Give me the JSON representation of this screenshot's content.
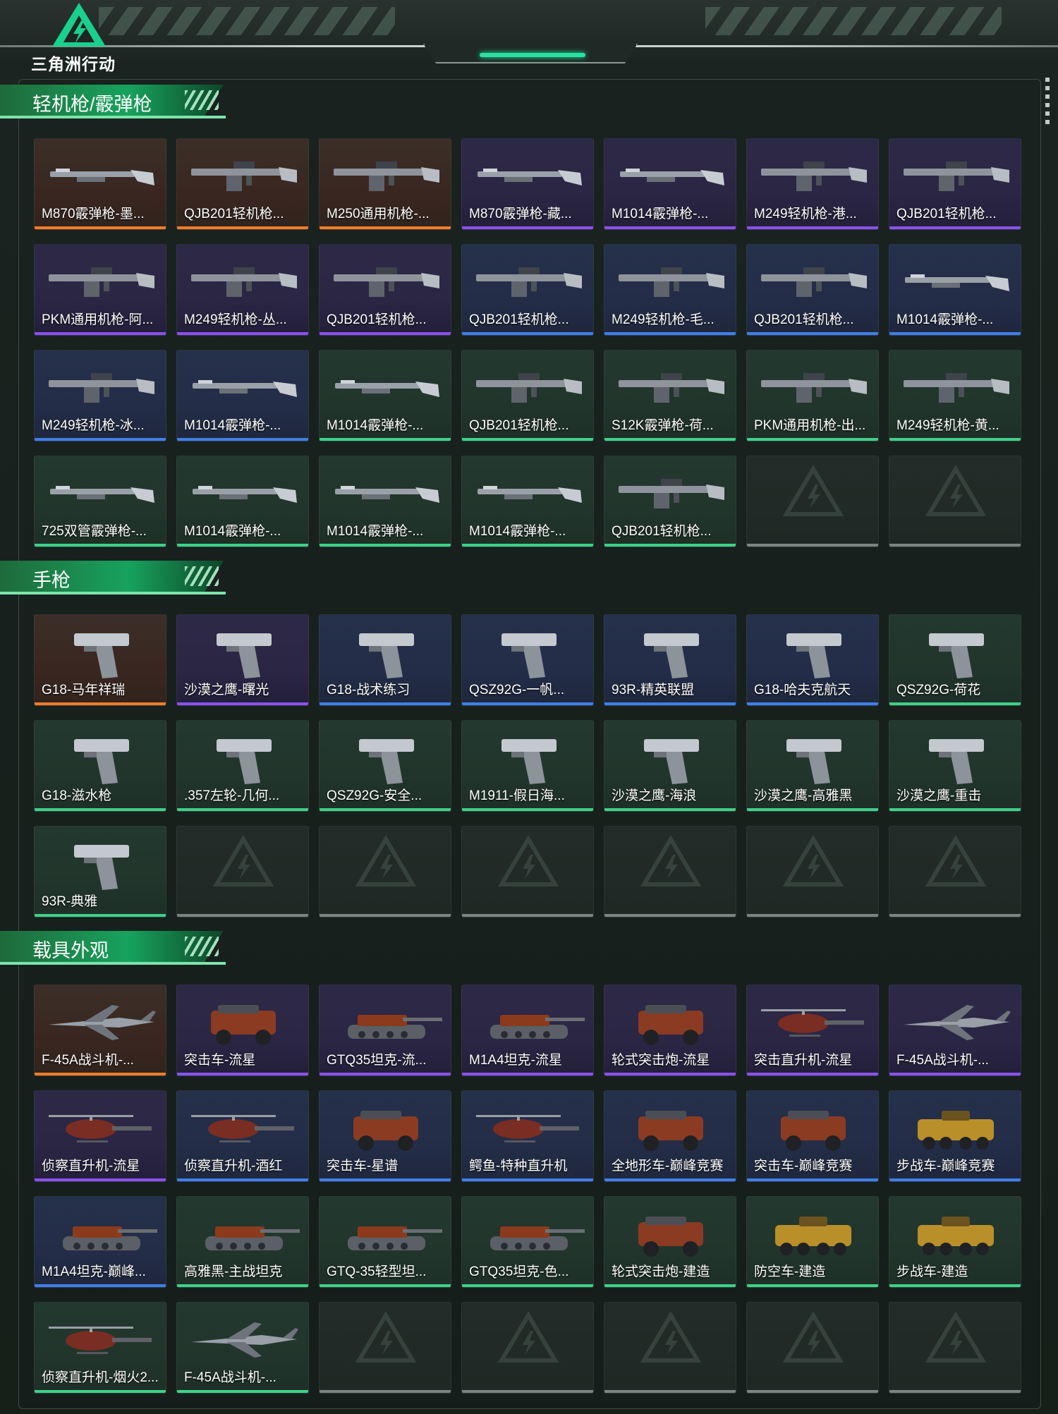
{
  "header": {
    "logo_text": "三角洲行动"
  },
  "sections": [
    {
      "title": "轻机枪/霰弹枪",
      "items": [
        {
          "name": "M870霰弹枪-墨...",
          "rarity": "orange",
          "icon": "shotgun"
        },
        {
          "name": "QJB201轻机枪...",
          "rarity": "orange",
          "icon": "lmg"
        },
        {
          "name": "M250通用机枪-...",
          "rarity": "orange",
          "icon": "lmg"
        },
        {
          "name": "M870霰弹枪-藏...",
          "rarity": "purple",
          "icon": "shotgun"
        },
        {
          "name": "M1014霰弹枪-...",
          "rarity": "purple",
          "icon": "shotgun"
        },
        {
          "name": "M249轻机枪-港...",
          "rarity": "purple",
          "icon": "lmg"
        },
        {
          "name": "QJB201轻机枪...",
          "rarity": "purple",
          "icon": "lmg"
        },
        {
          "name": "PKM通用机枪-阿...",
          "rarity": "purple",
          "icon": "lmg"
        },
        {
          "name": "M249轻机枪-丛...",
          "rarity": "purple",
          "icon": "lmg"
        },
        {
          "name": "QJB201轻机枪...",
          "rarity": "purple",
          "icon": "lmg"
        },
        {
          "name": "QJB201轻机枪...",
          "rarity": "blue",
          "icon": "lmg"
        },
        {
          "name": "M249轻机枪-毛...",
          "rarity": "blue",
          "icon": "lmg"
        },
        {
          "name": "QJB201轻机枪...",
          "rarity": "blue",
          "icon": "lmg"
        },
        {
          "name": "M1014霰弹枪-...",
          "rarity": "blue",
          "icon": "shotgun"
        },
        {
          "name": "M249轻机枪-冰...",
          "rarity": "blue",
          "icon": "lmg"
        },
        {
          "name": "M1014霰弹枪-...",
          "rarity": "blue",
          "icon": "shotgun"
        },
        {
          "name": "M1014霰弹枪-...",
          "rarity": "green",
          "icon": "shotgun"
        },
        {
          "name": "QJB201轻机枪...",
          "rarity": "green",
          "icon": "lmg"
        },
        {
          "name": "S12K霰弹枪-荷...",
          "rarity": "green",
          "icon": "lmg"
        },
        {
          "name": "PKM通用机枪-出...",
          "rarity": "green",
          "icon": "lmg"
        },
        {
          "name": "M249轻机枪-黄...",
          "rarity": "green",
          "icon": "lmg"
        },
        {
          "name": "725双管霰弹枪-...",
          "rarity": "green",
          "icon": "shotgun"
        },
        {
          "name": "M1014霰弹枪-...",
          "rarity": "green",
          "icon": "shotgun"
        },
        {
          "name": "M1014霰弹枪-...",
          "rarity": "green",
          "icon": "shotgun"
        },
        {
          "name": "M1014霰弹枪-...",
          "rarity": "green",
          "icon": "shotgun"
        },
        {
          "name": "QJB201轻机枪...",
          "rarity": "green",
          "icon": "lmg"
        },
        {
          "name": "",
          "rarity": "empty",
          "icon": "placeholder"
        },
        {
          "name": "",
          "rarity": "empty",
          "icon": "placeholder"
        }
      ]
    },
    {
      "title": "手枪",
      "items": [
        {
          "name": "G18-马年祥瑞",
          "rarity": "orange",
          "icon": "pistol"
        },
        {
          "name": "沙漠之鹰-曙光",
          "rarity": "purple",
          "icon": "pistol"
        },
        {
          "name": "G18-战术练习",
          "rarity": "blue",
          "icon": "pistol"
        },
        {
          "name": "QSZ92G-一帆...",
          "rarity": "blue",
          "icon": "pistol"
        },
        {
          "name": "93R-精英联盟",
          "rarity": "blue",
          "icon": "pistol"
        },
        {
          "name": "G18-哈夫克航天",
          "rarity": "blue",
          "icon": "pistol"
        },
        {
          "name": "QSZ92G-荷花",
          "rarity": "green",
          "icon": "pistol"
        },
        {
          "name": "G18-滋水枪",
          "rarity": "green",
          "icon": "pistol"
        },
        {
          "name": ".357左轮-几何...",
          "rarity": "green",
          "icon": "pistol"
        },
        {
          "name": "QSZ92G-安全...",
          "rarity": "green",
          "icon": "pistol"
        },
        {
          "name": "M1911-假日海...",
          "rarity": "green",
          "icon": "pistol"
        },
        {
          "name": "沙漠之鹰-海浪",
          "rarity": "green",
          "icon": "pistol"
        },
        {
          "name": "沙漠之鹰-高雅黑",
          "rarity": "green",
          "icon": "pistol"
        },
        {
          "name": "沙漠之鹰-重击",
          "rarity": "green",
          "icon": "pistol"
        },
        {
          "name": "93R-典雅",
          "rarity": "green",
          "icon": "pistol"
        },
        {
          "name": "",
          "rarity": "empty",
          "icon": "placeholder"
        },
        {
          "name": "",
          "rarity": "empty",
          "icon": "placeholder"
        },
        {
          "name": "",
          "rarity": "empty",
          "icon": "placeholder"
        },
        {
          "name": "",
          "rarity": "empty",
          "icon": "placeholder"
        },
        {
          "name": "",
          "rarity": "empty",
          "icon": "placeholder"
        },
        {
          "name": "",
          "rarity": "empty",
          "icon": "placeholder"
        }
      ]
    },
    {
      "title": "载具外观",
      "items": [
        {
          "name": "F-45A战斗机-...",
          "rarity": "orange",
          "icon": "jet"
        },
        {
          "name": "突击车-流星",
          "rarity": "purple",
          "icon": "truck"
        },
        {
          "name": "GTQ35坦克-流...",
          "rarity": "purple",
          "icon": "tank"
        },
        {
          "name": "M1A4坦克-流星",
          "rarity": "purple",
          "icon": "tank"
        },
        {
          "name": "轮式突击炮-流星",
          "rarity": "purple",
          "icon": "truck"
        },
        {
          "name": "突击直升机-流星",
          "rarity": "purple",
          "icon": "heli"
        },
        {
          "name": "F-45A战斗机-...",
          "rarity": "purple",
          "icon": "jet"
        },
        {
          "name": "侦察直升机-流星",
          "rarity": "purple",
          "icon": "heli"
        },
        {
          "name": "侦察直升机-酒红",
          "rarity": "blue",
          "icon": "heli"
        },
        {
          "name": "突击车-星谱",
          "rarity": "blue",
          "icon": "truck"
        },
        {
          "name": "鳄鱼-特种直升机",
          "rarity": "blue",
          "icon": "heli"
        },
        {
          "name": "全地形车-巅峰竞赛",
          "rarity": "blue",
          "icon": "truck"
        },
        {
          "name": "突击车-巅峰竞赛",
          "rarity": "blue",
          "icon": "truck"
        },
        {
          "name": "步战车-巅峰竞赛",
          "rarity": "blue",
          "icon": "apc"
        },
        {
          "name": "M1A4坦克-巅峰...",
          "rarity": "blue",
          "icon": "tank"
        },
        {
          "name": "高雅黑-主战坦克",
          "rarity": "green",
          "icon": "tank"
        },
        {
          "name": "GTQ-35轻型坦...",
          "rarity": "green",
          "icon": "tank"
        },
        {
          "name": "GTQ35坦克-色...",
          "rarity": "green",
          "icon": "tank"
        },
        {
          "name": "轮式突击炮-建造",
          "rarity": "green",
          "icon": "truck"
        },
        {
          "name": "防空车-建造",
          "rarity": "green",
          "icon": "apc"
        },
        {
          "name": "步战车-建造",
          "rarity": "green",
          "icon": "apc"
        },
        {
          "name": "侦察直升机-烟火2...",
          "rarity": "green",
          "icon": "heli"
        },
        {
          "name": "F-45A战斗机-...",
          "rarity": "green",
          "icon": "jet"
        },
        {
          "name": "",
          "rarity": "empty",
          "icon": "placeholder"
        },
        {
          "name": "",
          "rarity": "empty",
          "icon": "placeholder"
        },
        {
          "name": "",
          "rarity": "empty",
          "icon": "placeholder"
        },
        {
          "name": "",
          "rarity": "empty",
          "icon": "placeholder"
        },
        {
          "name": "",
          "rarity": "empty",
          "icon": "placeholder"
        }
      ]
    }
  ]
}
